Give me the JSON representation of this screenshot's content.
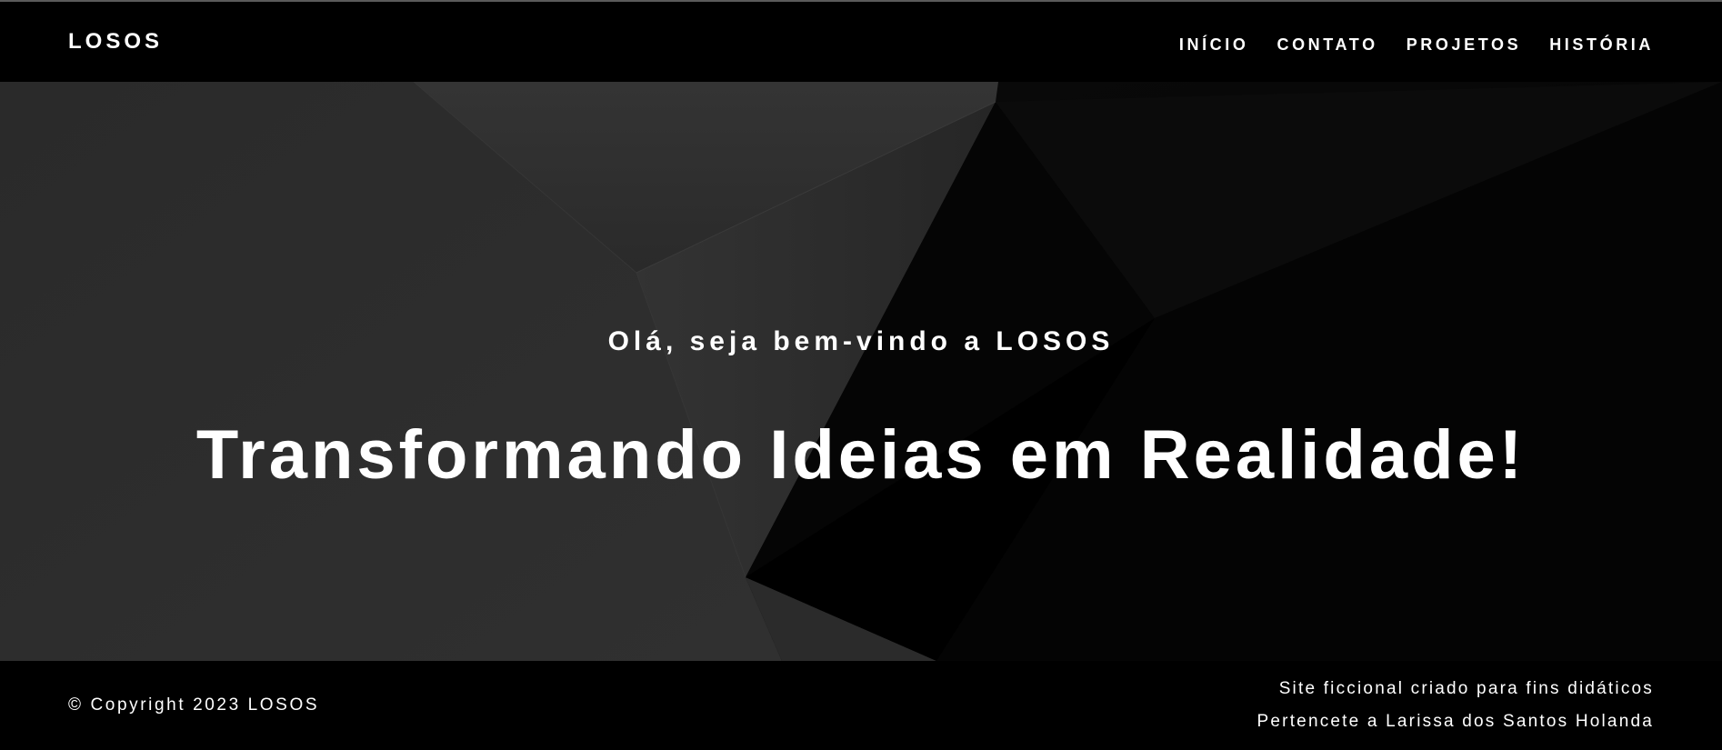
{
  "header": {
    "logo": "LOSOS",
    "nav": [
      {
        "label": "INÍCIO"
      },
      {
        "label": "CONTATO"
      },
      {
        "label": "PROJETOS"
      },
      {
        "label": "HISTÓRIA"
      }
    ]
  },
  "hero": {
    "greeting": "Olá, seja bem-vindo a LOSOS",
    "title": "Transformando Ideias em Realidade!"
  },
  "footer": {
    "copyright": "© Copyright 2023 LOSOS",
    "notes": [
      "Site ficcional criado para fins didáticos",
      "Pertencete a Larissa dos Santos Holanda"
    ]
  },
  "colors": {
    "background": "#000000",
    "hero_light_facet": "#2e2e2e",
    "text": "#ffffff"
  }
}
